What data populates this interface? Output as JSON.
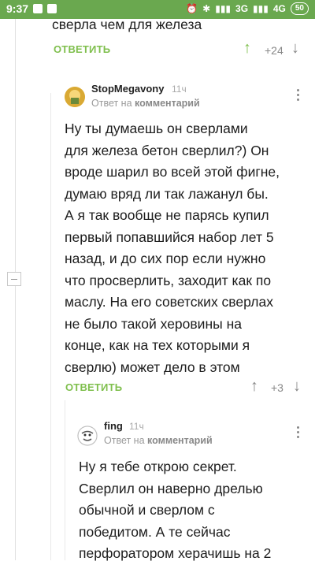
{
  "status": {
    "time": "9:37",
    "network": "3G",
    "network2": "4G",
    "battery": "50"
  },
  "top_comment": {
    "tail_text": "сверла чем для железа",
    "reply_label": "ОТВЕТИТЬ",
    "score": "+24"
  },
  "comment1": {
    "author": "StopMegavony",
    "time": "11ч",
    "meta_prefix": "Ответ на",
    "meta_link": "комментарий",
    "lines": [
      "Ну ты думаешь он сверлами",
      "для железа бетон сверлил?) Он",
      "вроде шарил во всей этой фигне,",
      "думаю вряд ли так лажанул бы.",
      "А я так вообще не парясь купил",
      "первый попавшийся набор лет 5",
      "назад, и до сих пор если нужно",
      "что просверлить, заходит как по",
      "маслу. На его советских сверлах",
      "не было такой херовины на",
      "конце, как на тех которыми я",
      "сверлю) может дело в этом"
    ],
    "reply_label": "ОТВЕТИТЬ",
    "score": "+3"
  },
  "comment2": {
    "author": "fing",
    "time": "11ч",
    "meta_prefix": "Ответ на",
    "meta_link": "комментарий",
    "lines": [
      "Ну я тебе открою секрет.",
      "Сверлил он наверно дрелью",
      "обычной и сверлом с",
      "победитом. А те сейчас",
      "перфоратором херачишь на 2"
    ]
  },
  "colors": {
    "statusbar": "#6aa84f",
    "accent": "#7fbf4d"
  }
}
